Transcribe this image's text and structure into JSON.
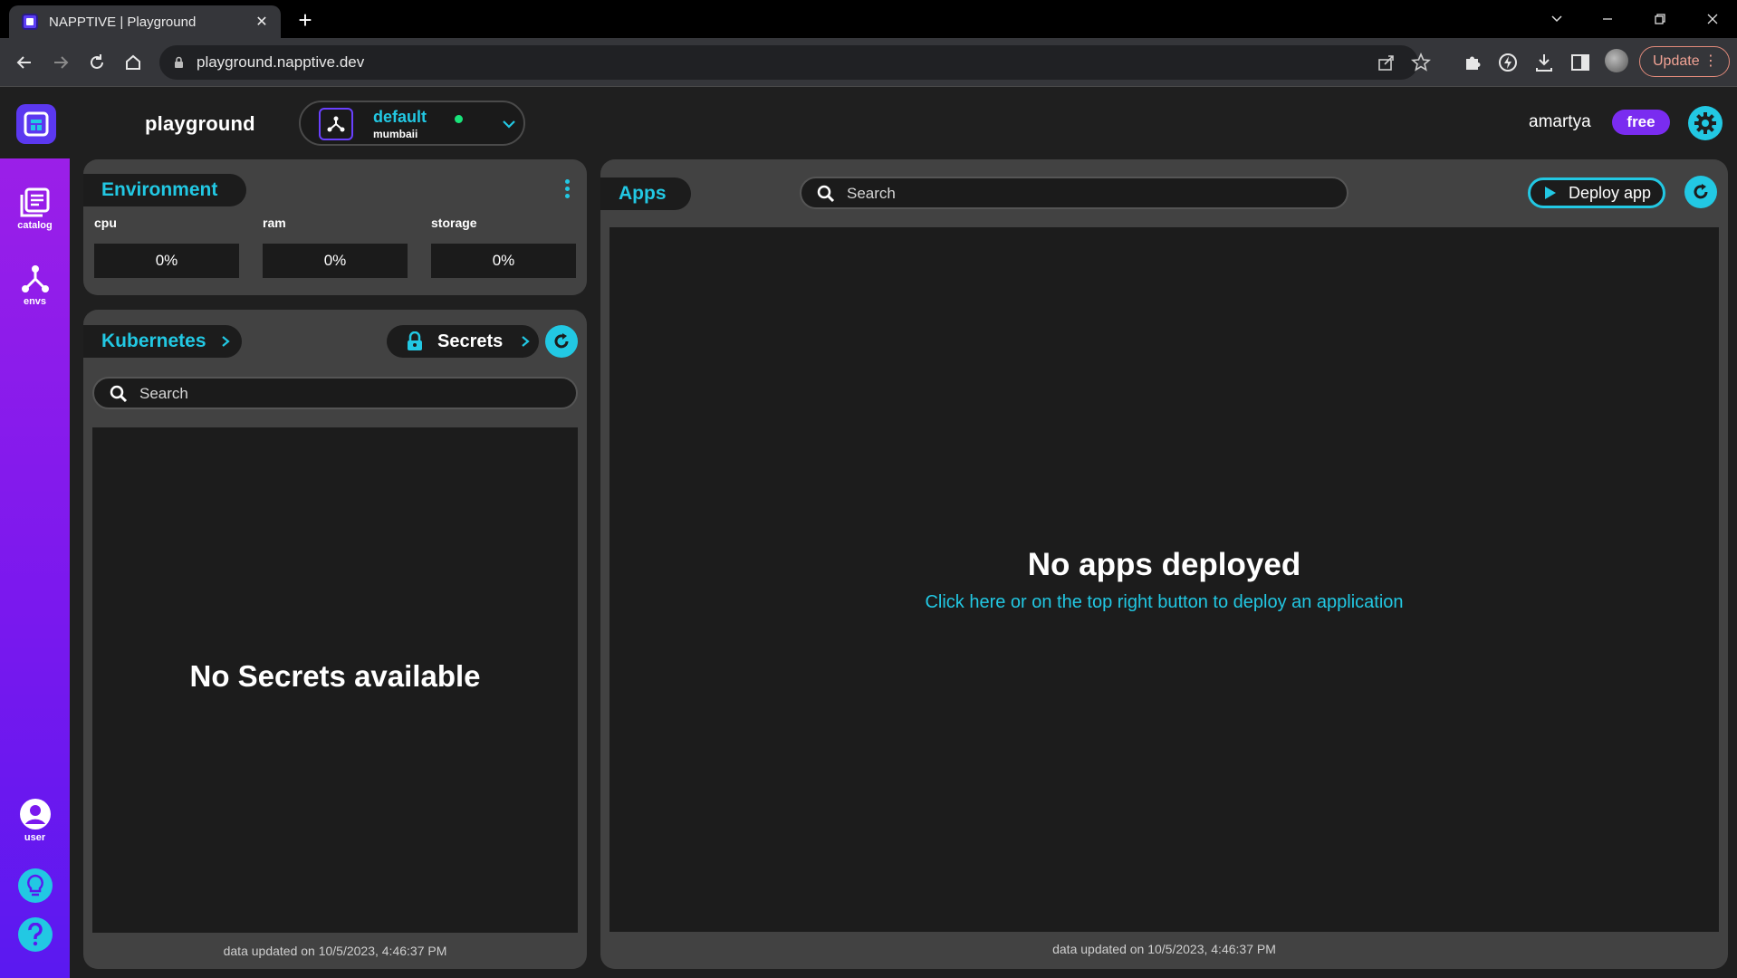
{
  "browser": {
    "tab_title": "NAPPTIVE | Playground",
    "url": "playground.napptive.dev",
    "update_label": "Update"
  },
  "header": {
    "brand": "playground",
    "env": {
      "name": "default",
      "region": "mumbaii",
      "status_color": "#19e37a"
    },
    "username": "amartya",
    "plan": "free"
  },
  "rail": {
    "catalog_label": "catalog",
    "envs_label": "envs",
    "user_label": "user"
  },
  "environment": {
    "title": "Environment",
    "metrics": [
      {
        "label": "cpu",
        "value": "0%"
      },
      {
        "label": "ram",
        "value": "0%"
      },
      {
        "label": "storage",
        "value": "0%"
      }
    ]
  },
  "kubernetes": {
    "title": "Kubernetes",
    "secrets_label": "Secrets",
    "search_placeholder": "Search",
    "empty_message": "No Secrets available",
    "updated_text": "data updated on 10/5/2023, 4:46:37 PM"
  },
  "apps": {
    "title": "Apps",
    "search_placeholder": "Search",
    "deploy_label": "Deploy app",
    "empty_title": "No apps deployed",
    "empty_hint": "Click here or on the top right button to deploy an application",
    "updated_text": "data updated on 10/5/2023, 4:46:37 PM"
  },
  "colors": {
    "accent": "#22c8e3",
    "brand_purple": "#5b38f0",
    "rail_top": "#9b1fe8",
    "rail_bottom": "#5a19f0",
    "panel": "#424242",
    "panel_inner": "#1c1c1c"
  }
}
